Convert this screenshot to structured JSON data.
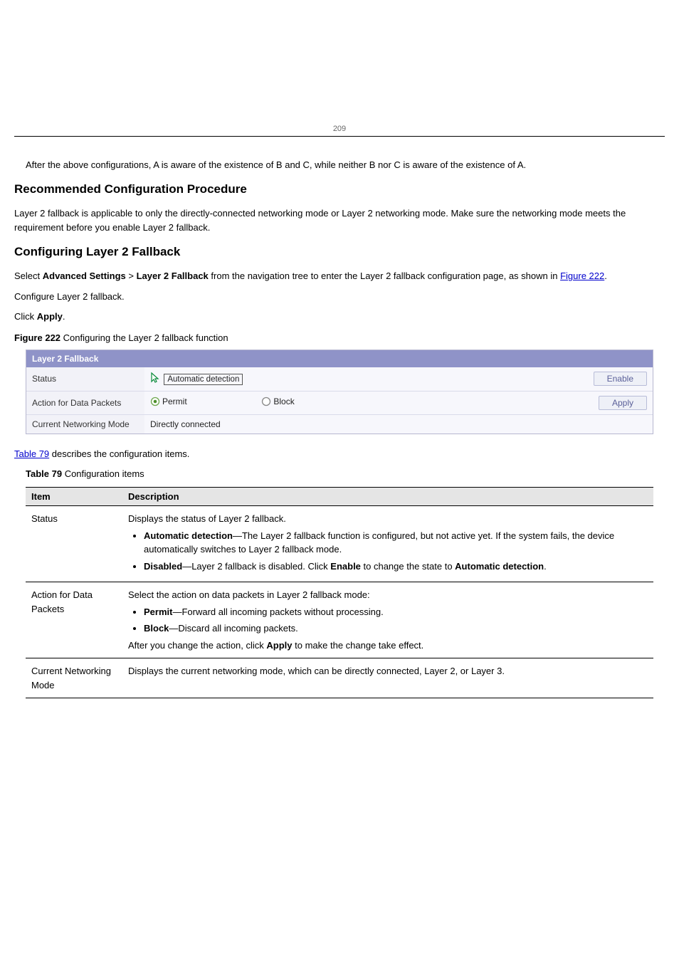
{
  "pageNumber": "209",
  "intro": "After the above configurations, A is aware of the existence of B and C, while neither B nor C is aware of the existence of A.",
  "section1": {
    "title": "Recommended Configuration Procedure",
    "text": "Layer 2 fallback is applicable to only the directly-connected networking mode or Layer 2 networking mode. Make sure the networking mode meets the requirement before you enable Layer 2 fallback."
  },
  "section2": {
    "title": "Configuring Layer 2 Fallback",
    "steps": [
      {
        "pre": "Select ",
        "bold": "Advanced Settings",
        "mid": " > ",
        "bold2": "Layer 2 Fallback",
        "post": " from the navigation tree to enter the Layer 2 fallback configuration page, as shown in "
      },
      {
        "linkText": "Figure 222",
        "post": "."
      },
      {
        "full": "Configure Layer 2 fallback."
      },
      {
        "pre": "Click ",
        "bold": "Apply",
        "post": "."
      }
    ],
    "figure": {
      "labelPrefix": "Figure 222",
      "caption": "Configuring the Layer 2 fallback function",
      "panel": {
        "header": "Layer 2 Fallback",
        "rows": [
          {
            "label": "Status",
            "value": "Automatic detection",
            "button": "Enable"
          },
          {
            "label": "Action for Data Packets",
            "radio1": "Permit",
            "radio2": "Block",
            "button": "Apply"
          },
          {
            "label": "Current Networking Mode",
            "value": "Directly connected"
          }
        ]
      }
    },
    "tableRef": {
      "linkText": "Table 79",
      "post": " describes the configuration items."
    },
    "table": {
      "labelPrefix": "Table 79",
      "caption": "Configuration items",
      "head": [
        "Item",
        "Description"
      ],
      "rows": [
        {
          "item": "Status",
          "desc": "Displays the status of Layer 2 fallback.",
          "bullets": [
            {
              "bold": "Automatic detection",
              "text": "—The Layer 2 fallback function is configured, but not active yet. If the system fails, the device automatically switches to Layer 2 fallback mode."
            },
            {
              "bold": "Disabled",
              "text": "—Layer 2 fallback is disabled. Click ",
              "bold2": "Enable",
              "text2": " to change the state to ",
              "bold3": "Automatic detection",
              "text3": "."
            }
          ]
        },
        {
          "item": "Action for Data Packets",
          "desc": "Select the action on data packets in Layer 2 fallback mode:",
          "bullets": [
            {
              "bold": "Permit",
              "text": "—Forward all incoming packets without processing."
            },
            {
              "bold": "Block",
              "text": "—Discard all incoming packets."
            }
          ],
          "tail": {
            "pre": "After you change the action, click ",
            "bold": "Apply",
            "post": " to make the change take effect."
          }
        },
        {
          "item": "Current Networking Mode",
          "descPlain": "Displays the current networking mode, which can be directly connected, Layer 2, or Layer 3."
        }
      ]
    }
  }
}
